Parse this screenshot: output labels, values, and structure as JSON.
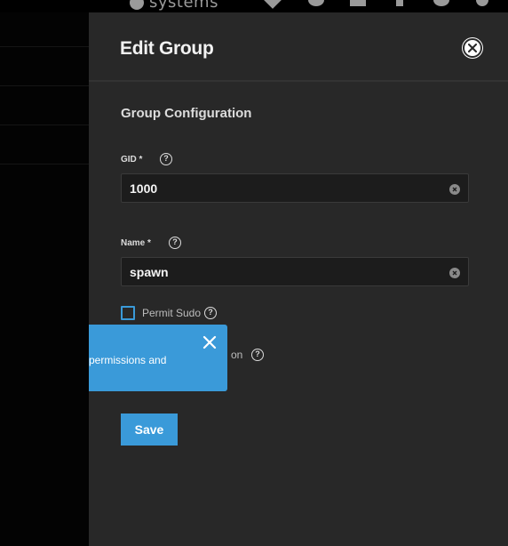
{
  "topbar": {
    "brand": "systems"
  },
  "panel": {
    "title": "Edit Group",
    "section_title": "Group Configuration",
    "gid": {
      "label": "GID *",
      "value": "1000"
    },
    "name": {
      "label": "Name *",
      "value": "spawn"
    },
    "permit_sudo": {
      "label": "Permit Sudo",
      "checked": false
    },
    "partial_label": "on",
    "save_label": "Save"
  },
  "tooltip": {
    "text": "permissions and"
  },
  "colors": {
    "accent": "#3a9ad9",
    "panel_bg": "#282828",
    "input_bg": "#1c1c1c"
  }
}
